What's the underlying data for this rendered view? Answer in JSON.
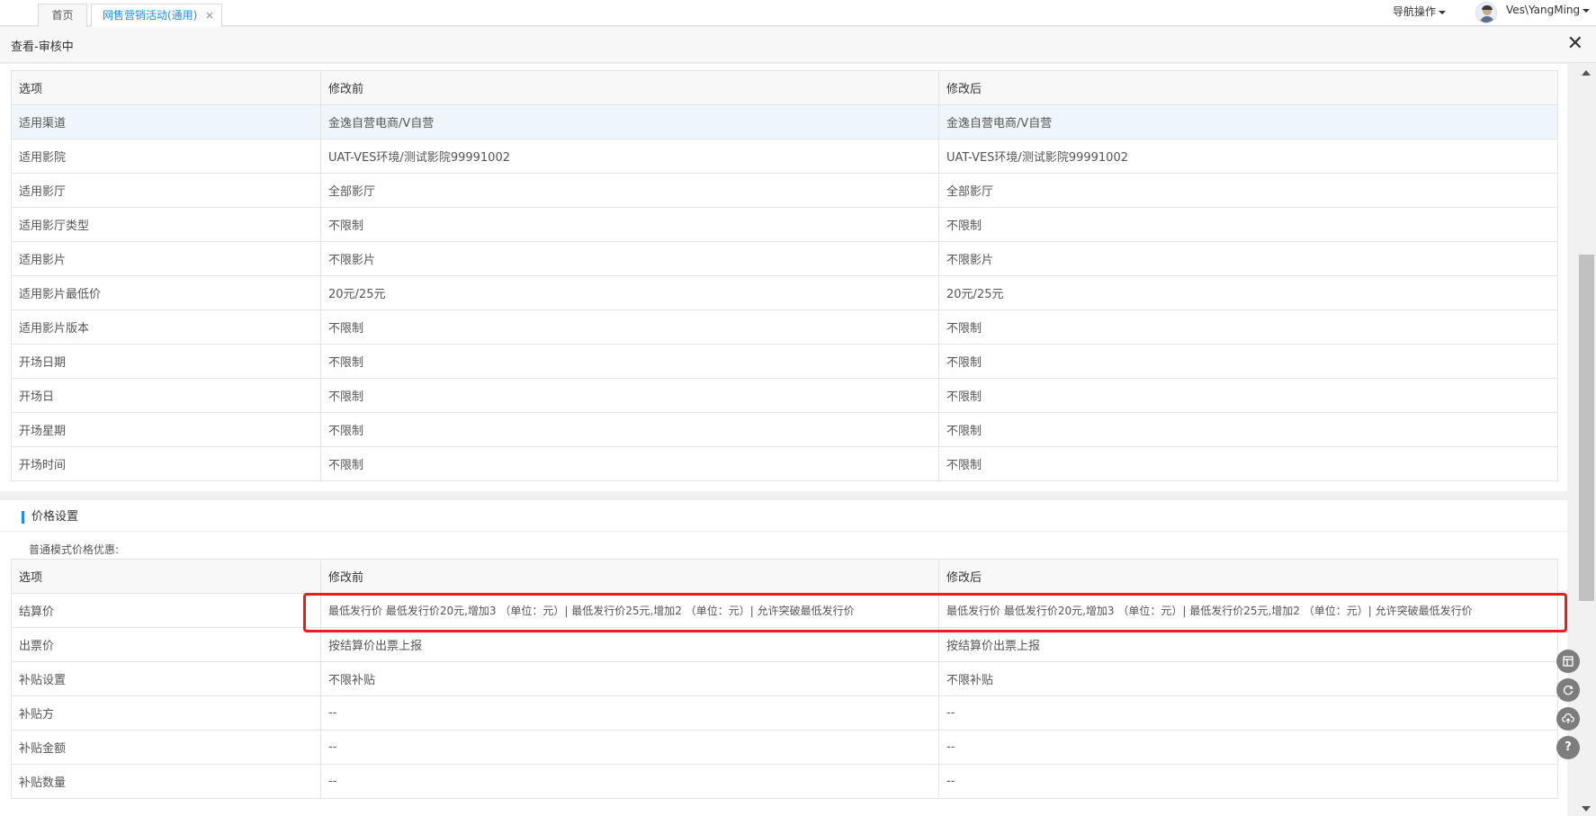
{
  "tabs": {
    "home": "首页",
    "active": "网售营销活动(通用)",
    "close_glyph": "×"
  },
  "header": {
    "nav_ops": "导航操作",
    "username": "Ves\\YangMing"
  },
  "panel": {
    "title": "查看-审核中",
    "close_glyph": "✕"
  },
  "table1": {
    "headers": [
      "选项",
      "修改前",
      "修改后"
    ],
    "rows": [
      [
        "适用渠道",
        "金逸自营电商/V自营",
        "金逸自营电商/V自营"
      ],
      [
        "适用影院",
        "UAT-VES环境/测试影院99991002",
        "UAT-VES环境/测试影院99991002"
      ],
      [
        "适用影厅",
        "全部影厅",
        "全部影厅"
      ],
      [
        "适用影厅类型",
        "不限制",
        "不限制"
      ],
      [
        "适用影片",
        "不限影片",
        "不限影片"
      ],
      [
        "适用影片最低价",
        "20元/25元",
        "20元/25元"
      ],
      [
        "适用影片版本",
        "不限制",
        "不限制"
      ],
      [
        "开场日期",
        "不限制",
        "不限制"
      ],
      [
        "开场日",
        "不限制",
        "不限制"
      ],
      [
        "开场星期",
        "不限制",
        "不限制"
      ],
      [
        "开场时间",
        "不限制",
        "不限制"
      ]
    ]
  },
  "price_section": {
    "title": "价格设置",
    "sub_label": "普通模式价格优惠:"
  },
  "table2": {
    "headers": [
      "选项",
      "修改前",
      "修改后"
    ],
    "rows": [
      [
        "结算价",
        "最低发行价 最低发行价20元,增加3 （单位：元）| 最低发行价25元,增加2 （单位：元）| 允许突破最低发行价",
        "最低发行价 最低发行价20元,增加3 （单位：元）| 最低发行价25元,增加2 （单位：元）| 允许突破最低发行价"
      ],
      [
        "出票价",
        "按结算价出票上报",
        "按结算价出票上报"
      ],
      [
        "补贴设置",
        "不限补贴",
        "不限补贴"
      ],
      [
        "补贴方",
        "--",
        "--"
      ],
      [
        "补贴金额",
        "--",
        "--"
      ],
      [
        "补贴数量",
        "--",
        "--"
      ]
    ]
  },
  "tools": {
    "help_glyph": "?",
    "icons": [
      "table-icon",
      "refresh-icon",
      "cloud-upload-icon",
      "help-icon"
    ]
  },
  "colors": {
    "accent": "#1a8cff",
    "highlight_box": "#ee1c1c",
    "row_highlight": "#eef6fb"
  }
}
